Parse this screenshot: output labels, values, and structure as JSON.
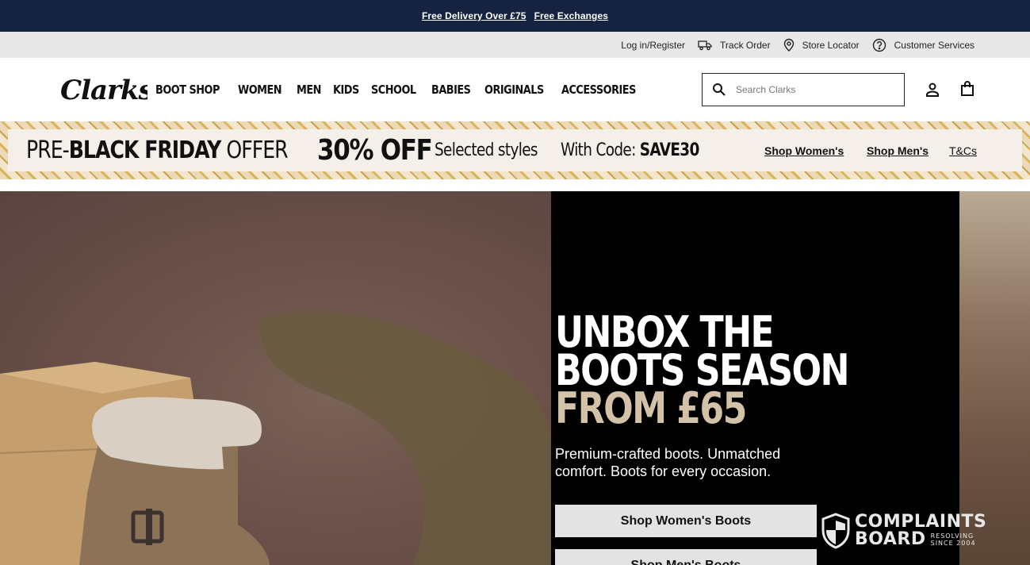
{
  "promo": {
    "links": [
      "Free Delivery Over £75",
      "Free Exchanges"
    ]
  },
  "utility": {
    "login": "Log in/Register",
    "track_order": "Track Order",
    "store_locator": "Store Locator",
    "customer_services": "Customer Services"
  },
  "header": {
    "logo_text": "Clarks",
    "nav": [
      "BOOT SHOP",
      "WOMEN",
      "MEN",
      "KIDS",
      "SCHOOL",
      "BABIES",
      "ORIGINALS",
      "ACCESSORIES"
    ],
    "search_placeholder": "Search Clarks"
  },
  "offer_banner": {
    "title_pre": "PRE-",
    "title_bold": "BLACK FRIDAY",
    "title_post": " OFFER",
    "discount": "30% OFF",
    "selected": "Selected styles",
    "code_label": "With Code:",
    "code": "SAVE30",
    "shop_women": "Shop Women's",
    "shop_men": "Shop Men's",
    "terms": "T&Cs"
  },
  "hero": {
    "heading_line1": "UNBOX THE",
    "heading_line2": "BOOTS SEASON",
    "heading_line3": "FROM £65",
    "subtext": "Premium-crafted boots. Unmatched comfort. Boots for every occasion.",
    "btn_women": "Shop Women's Boots",
    "btn_men": "Shop Men's Boots"
  },
  "badge": {
    "line1": "COMPLAINTS",
    "line2": "BOARD",
    "small1": "RESOLVING",
    "small2": "SINCE 2004"
  },
  "colors": {
    "promo_bg": "#152340",
    "utility_bg": "#e8e8e8",
    "hero_price": "#d3c2a8"
  }
}
